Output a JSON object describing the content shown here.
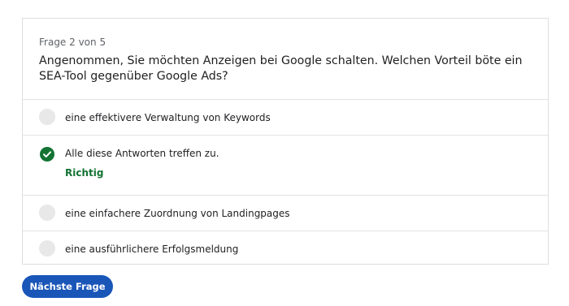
{
  "quiz": {
    "counter": "Frage 2 von 5",
    "question": "Angenommen, Sie möchten Anzeigen bei Google schalten. Welchen Vorteil böte ein SEA-Tool gegenüber Google Ads?",
    "options": [
      {
        "label": "eine effektivere Verwaltung von Keywords",
        "state": "unselected"
      },
      {
        "label": "Alle diese Antworten treffen zu.",
        "state": "correct",
        "feedback": "Richtig"
      },
      {
        "label": "eine einfachere Zuordnung von Landingpages",
        "state": "unselected"
      },
      {
        "label": "eine ausführlichere Erfolgsmeldung",
        "state": "unselected"
      }
    ],
    "next_button": "Nächste Frage"
  },
  "colors": {
    "accent": "#1a56b8",
    "correct": "#137333",
    "radio_empty": "#e8e8e8",
    "border": "#dedede"
  },
  "icons": {
    "correct": "checkmark-circle-icon",
    "unselected": "radio-empty-icon"
  }
}
